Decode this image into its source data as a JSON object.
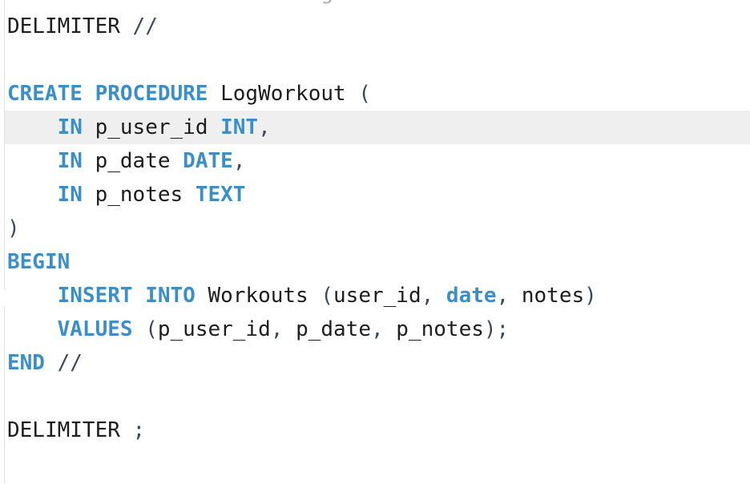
{
  "editor": {
    "partial_top_line": "-- Stored Procedure to Log a Workout",
    "lines": {
      "l1": {
        "t1": "DELIMITER",
        "t2": " //"
      },
      "l3": {
        "k1": "CREATE",
        "sp1": " ",
        "k2": "PROCEDURE",
        "t1": " LogWorkout ",
        "p1": "("
      },
      "l4": {
        "ind": "    ",
        "k1": "IN",
        "t1": " p_user_id ",
        "k2": "INT",
        "p1": ","
      },
      "l5": {
        "ind": "    ",
        "k1": "IN",
        "t1": " p_date ",
        "k2": "DATE",
        "p1": ","
      },
      "l6": {
        "ind": "    ",
        "k1": "IN",
        "t1": " p_notes ",
        "k2": "TEXT"
      },
      "l7": {
        "p1": ")"
      },
      "l8": {
        "k1": "BEGIN"
      },
      "l9": {
        "ind": "    ",
        "k1": "INSERT",
        "sp1": " ",
        "k2": "INTO",
        "t1": " Workouts ",
        "p1": "(",
        "t2": "user_id",
        "p2": ", ",
        "k3": "date",
        "p3": ", ",
        "t3": "notes",
        "p4": ")"
      },
      "l10": {
        "ind": "    ",
        "k1": "VALUES",
        "sp1": " ",
        "p1": "(",
        "t1": "p_user_id",
        "p2": ", ",
        "t2": "p_date",
        "p3": ", ",
        "t3": "p_notes",
        "p4": ");"
      },
      "l11": {
        "k1": "END",
        "t1": " //"
      },
      "l13": {
        "t1": "DELIMITER",
        "t2": " ;"
      }
    }
  }
}
